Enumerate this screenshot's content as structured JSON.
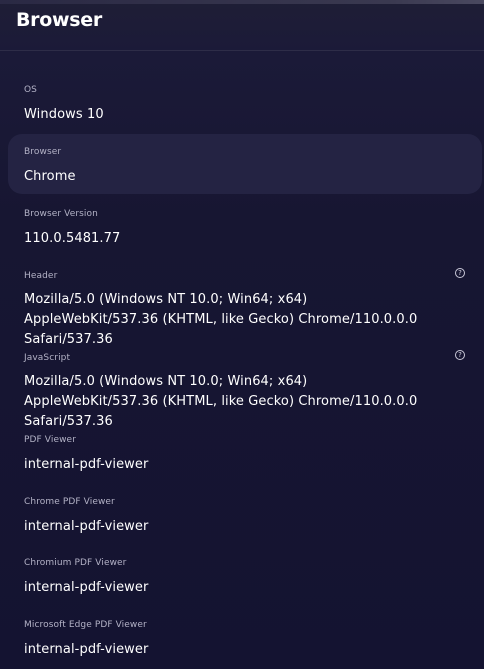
{
  "panel": {
    "title": "Browser"
  },
  "fields": {
    "os": {
      "label": "OS",
      "value": "Windows 10"
    },
    "browser": {
      "label": "Browser",
      "value": "Chrome"
    },
    "browser_version": {
      "label": "Browser Version",
      "value": "110.0.5481.77"
    },
    "header": {
      "label": "Header",
      "value": "Mozilla/5.0 (Windows NT 10.0; Win64; x64) AppleWebKit/537.36 (KHTML, like Gecko) Chrome/110.0.0.0 Safari/537.36"
    },
    "javascript": {
      "label": "JavaScript",
      "value": "Mozilla/5.0 (Windows NT 10.0; Win64; x64) AppleWebKit/537.36 (KHTML, like Gecko) Chrome/110.0.0.0 Safari/537.36"
    },
    "pdf_viewer": {
      "label": "PDF Viewer",
      "value": "internal-pdf-viewer"
    },
    "chrome_pdf_viewer": {
      "label": "Chrome PDF Viewer",
      "value": "internal-pdf-viewer"
    },
    "chromium_pdf_viewer": {
      "label": "Chromium PDF Viewer",
      "value": "internal-pdf-viewer"
    },
    "edge_pdf_viewer": {
      "label": "Microsoft Edge PDF Viewer",
      "value": "internal-pdf-viewer"
    }
  },
  "icons": {
    "help": "?"
  },
  "colors": {
    "background": "#171632",
    "highlight_row": "#242343",
    "label_text": "#b3b2c6",
    "value_text": "#ffffff"
  }
}
